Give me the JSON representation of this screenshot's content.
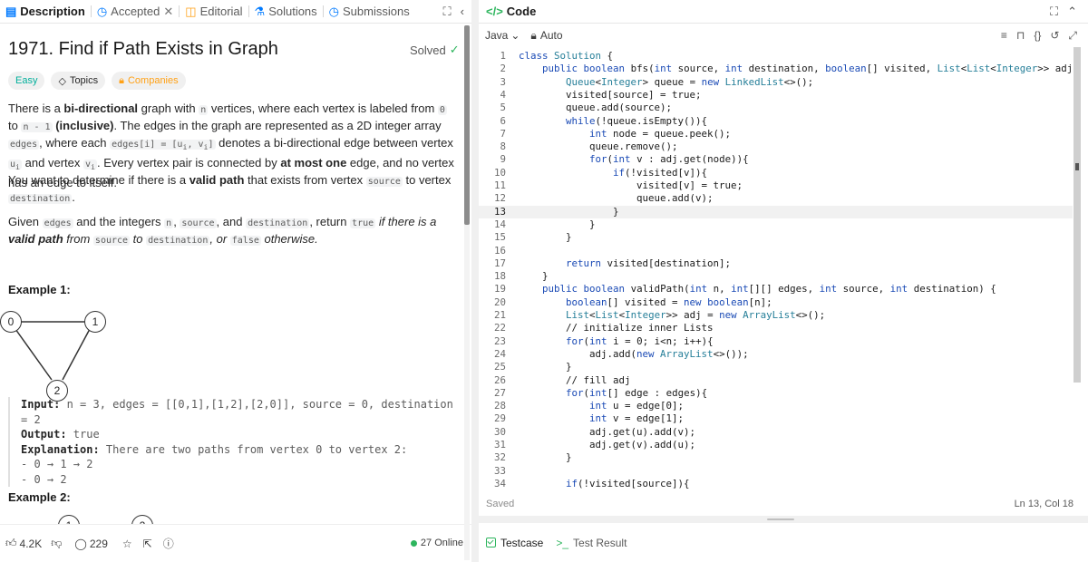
{
  "tabs": [
    {
      "label": "Description",
      "icon": "description-icon",
      "active": true
    },
    {
      "label": "Accepted",
      "icon": "clock-icon",
      "active": false
    },
    {
      "label": "Editorial",
      "icon": "book-icon",
      "active": false
    },
    {
      "label": "Solutions",
      "icon": "flask-icon",
      "active": false
    },
    {
      "label": "Submissions",
      "icon": "history-icon",
      "active": false
    }
  ],
  "problem": {
    "title": "1971. Find if Path Exists in Graph",
    "status": "Solved",
    "difficulty": "Easy",
    "topics_label": "Topics",
    "companies_label": "Companies"
  },
  "description": {
    "p1": [
      "There is a ",
      "bi-directional",
      " graph with ",
      "n",
      " vertices, where each vertex is labeled from ",
      "0",
      " to ",
      "n - 1",
      " (inclusive)",
      ". The edges in the graph are represented as a 2D integer array ",
      "edges",
      ", where each ",
      "edges[i] = [u",
      "i",
      ", v",
      "i",
      "]",
      " denotes a bi-directional edge between vertex ",
      "u",
      "i",
      " and vertex ",
      "v",
      "i",
      ". Every vertex pair is connected by ",
      "at most one",
      " edge, and no vertex has an edge to itself."
    ],
    "p2": [
      "You want to determine if there is a ",
      "valid path",
      " that exists from vertex ",
      "source",
      " to vertex ",
      "destination",
      "."
    ],
    "p3": [
      "Given ",
      "edges",
      " and the integers ",
      "n",
      ", ",
      "source",
      ", and ",
      "destination",
      ", return ",
      "true",
      " if there is a ",
      "valid path",
      " from ",
      "source",
      " to ",
      "destination",
      ", or ",
      "false",
      " otherwise."
    ]
  },
  "example1": {
    "heading": "Example 1:",
    "nodes": [
      "0",
      "1",
      "2"
    ],
    "input_label": "Input:",
    "input": " n = 3, edges = [[0,1],[1,2],[2,0]], source = 0, destination = 2",
    "output_label": "Output:",
    "output": " true",
    "explanation_label": "Explanation:",
    "explanation": " There are two paths from vertex 0 to vertex 2:",
    "paths": [
      "- 0 → 1 → 2",
      "- 0 → 2"
    ]
  },
  "example2": {
    "heading": "Example 2:",
    "nodes": [
      "1",
      "2"
    ]
  },
  "footer": {
    "likes": "4.2K",
    "comments": "229",
    "online": "27 Online"
  },
  "editor": {
    "header": "Code",
    "language": "Java",
    "mode": "Auto",
    "saved": "Saved",
    "cursor": "Ln 13, Col 18",
    "current_line": 13,
    "lines": [
      "class Solution {",
      "    public boolean bfs(int source, int destination, boolean[] visited, List<List<Integer>> adj){",
      "        Queue<Integer> queue = new LinkedList<>();",
      "        visited[source] = true;",
      "        queue.add(source);",
      "        while(!queue.isEmpty()){",
      "            int node = queue.peek();",
      "            queue.remove();",
      "            for(int v : adj.get(node)){",
      "                if(!visited[v]){",
      "                    visited[v] = true;",
      "                    queue.add(v);",
      "                }",
      "            }",
      "        }",
      "",
      "        return visited[destination];",
      "    }",
      "    public boolean validPath(int n, int[][] edges, int source, int destination) {",
      "        boolean[] visited = new boolean[n];",
      "        List<List<Integer>> adj = new ArrayList<>();",
      "        // initialize inner Lists",
      "        for(int i = 0; i<n; i++){",
      "            adj.add(new ArrayList<>());",
      "        }",
      "        // fill adj",
      "        for(int[] edge : edges){",
      "            int u = edge[0];",
      "            int v = edge[1];",
      "            adj.get(u).add(v);",
      "            adj.get(v).add(u);",
      "        }",
      "",
      "        if(!visited[source]){"
    ]
  },
  "bottom_tabs": [
    {
      "label": "Testcase",
      "active": true
    },
    {
      "label": "Test Result",
      "active": false
    }
  ]
}
